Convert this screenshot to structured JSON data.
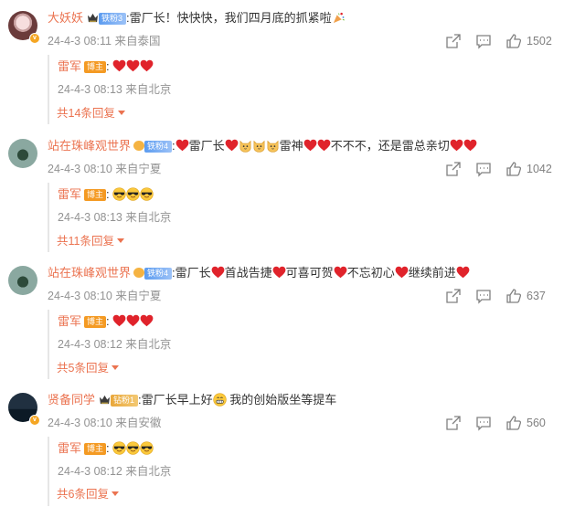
{
  "comments": [
    {
      "username": "大妖妖",
      "fan_badge": "铁粉3",
      "text_parts": [
        ":雷厂长！快快快，我们四月底的抓紧啦",
        "🎉"
      ],
      "time": "24-4-3 08:11",
      "location": "来自泰国",
      "likes": "1502",
      "reply": {
        "username": "雷军",
        "badge": "博主",
        "text": ":",
        "emoji": [
          "heart",
          "heart",
          "heart"
        ],
        "time": "24-4-3 08:13",
        "location": "来自北京"
      },
      "more_replies": "共14条回复"
    },
    {
      "username": "站在珠峰观世界",
      "fan_badge": "铁粉4",
      "text_segments": [
        ":",
        "雷厂长",
        "雷神",
        "不不不，还是雷总亲切"
      ],
      "time": "24-4-3 08:10",
      "location": "来自宁夏",
      "likes": "1042",
      "reply": {
        "username": "雷军",
        "badge": "博主",
        "text": ":",
        "emoji": [
          "cool",
          "cool",
          "cool"
        ],
        "time": "24-4-3 08:13",
        "location": "来自北京"
      },
      "more_replies": "共11条回复"
    },
    {
      "username": "站在珠峰观世界",
      "fan_badge": "铁粉4",
      "text_segments": [
        ":雷厂长",
        "首战告捷",
        "可喜可贺",
        "不忘初心",
        "继续前进"
      ],
      "time": "24-4-3 08:10",
      "location": "来自宁夏",
      "likes": "637",
      "reply": {
        "username": "雷军",
        "badge": "博主",
        "text": ":",
        "emoji": [
          "heart",
          "heart",
          "heart"
        ],
        "time": "24-4-3 08:12",
        "location": "来自北京"
      },
      "more_replies": "共5条回复"
    },
    {
      "username": "贤备同学",
      "fan_badge": "钻粉1",
      "text_segments": [
        ":雷厂长早上好",
        " 我的创始版坐等提车"
      ],
      "time": "24-4-3 08:10",
      "location": "来自安徽",
      "likes": "560",
      "reply": {
        "username": "雷军",
        "badge": "博主",
        "text": ":",
        "emoji": [
          "cool",
          "cool",
          "cool"
        ],
        "time": "24-4-3 08:12",
        "location": "来自北京"
      },
      "more_replies": "共6条回复"
    }
  ],
  "icons": {
    "share": "share-icon",
    "comment": "comment-icon",
    "like": "thumbs-up-icon"
  },
  "colors": {
    "username": "#eb7350",
    "meta": "#939393",
    "heart": "#e0232b",
    "blogger_badge": "#f49a23"
  }
}
